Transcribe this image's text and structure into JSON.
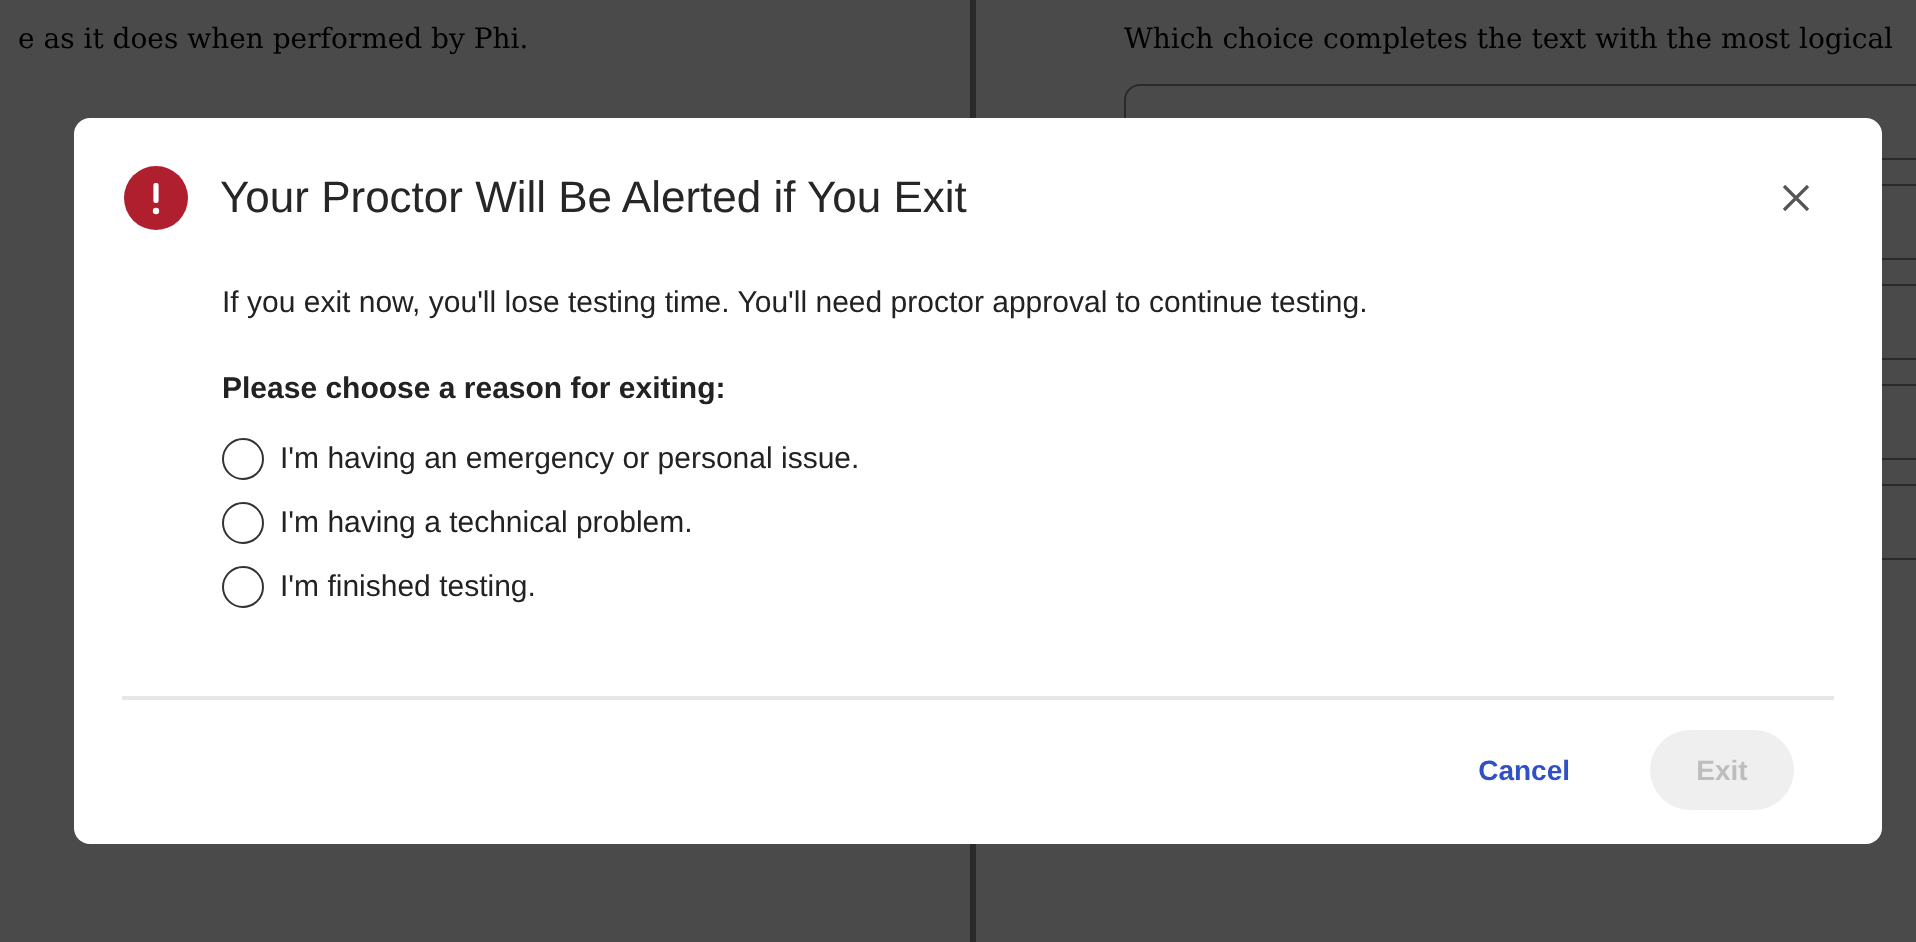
{
  "background": {
    "passage_text": "e as it does when performed by Phi.",
    "question_text": "Which choice completes the text with the most logical"
  },
  "dialog": {
    "title": "Your Proctor Will Be Alerted if You Exit",
    "message": "If you exit now, you'll lose testing time. You'll need proctor approval to continue testing.",
    "prompt": "Please choose a reason for exiting:",
    "options": [
      {
        "label": "I'm having an emergency or personal issue.",
        "selected": false
      },
      {
        "label": "I'm having a technical problem.",
        "selected": false
      },
      {
        "label": "I'm finished testing.",
        "selected": false
      }
    ],
    "buttons": [
      {
        "label": "Cancel",
        "kind": "text",
        "disabled": false
      },
      {
        "label": "Exit",
        "kind": "filled",
        "disabled": true
      }
    ]
  }
}
